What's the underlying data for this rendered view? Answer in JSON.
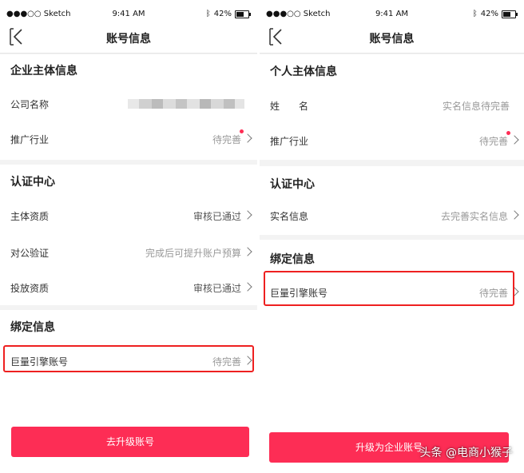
{
  "left": {
    "status": {
      "carrier": "●●●○○ Sketch",
      "time": "9:41 AM",
      "battery": "42%"
    },
    "nav": {
      "title": "账号信息"
    },
    "section_entity": {
      "title": "企业主体信息",
      "company_label": "公司名称",
      "industry_label": "推广行业",
      "industry_value": "待完善"
    },
    "section_cert": {
      "title": "认证中心",
      "rows": [
        {
          "label": "主体资质",
          "value": "审核已通过"
        },
        {
          "label": "对公验证",
          "value": "完成后可提升账户预算"
        },
        {
          "label": "投放资质",
          "value": "审核已通过"
        }
      ]
    },
    "section_bind": {
      "title": "绑定信息",
      "account_label": "巨量引擎账号",
      "account_value": "待完善"
    },
    "button": "去升级账号"
  },
  "right": {
    "status": {
      "carrier": "●●●○○ Sketch",
      "time": "9:41 AM",
      "battery": "42%"
    },
    "nav": {
      "title": "账号信息"
    },
    "section_entity": {
      "title": "个人主体信息",
      "name_label": "姓　　名",
      "name_value": "实名信息待完善",
      "industry_label": "推广行业",
      "industry_value": "待完善"
    },
    "section_cert": {
      "title": "认证中心",
      "realname_label": "实名信息",
      "realname_value": "去完善实名信息"
    },
    "section_bind": {
      "title": "绑定信息",
      "account_label": "巨量引擎账号",
      "account_value": "待完善"
    },
    "button": "升级为企业账号"
  },
  "watermark": "头条 @电商小猴子",
  "colors": {
    "accent": "#fd2d55",
    "highlight": "#ee2020",
    "reddot": "#ff2d55"
  }
}
